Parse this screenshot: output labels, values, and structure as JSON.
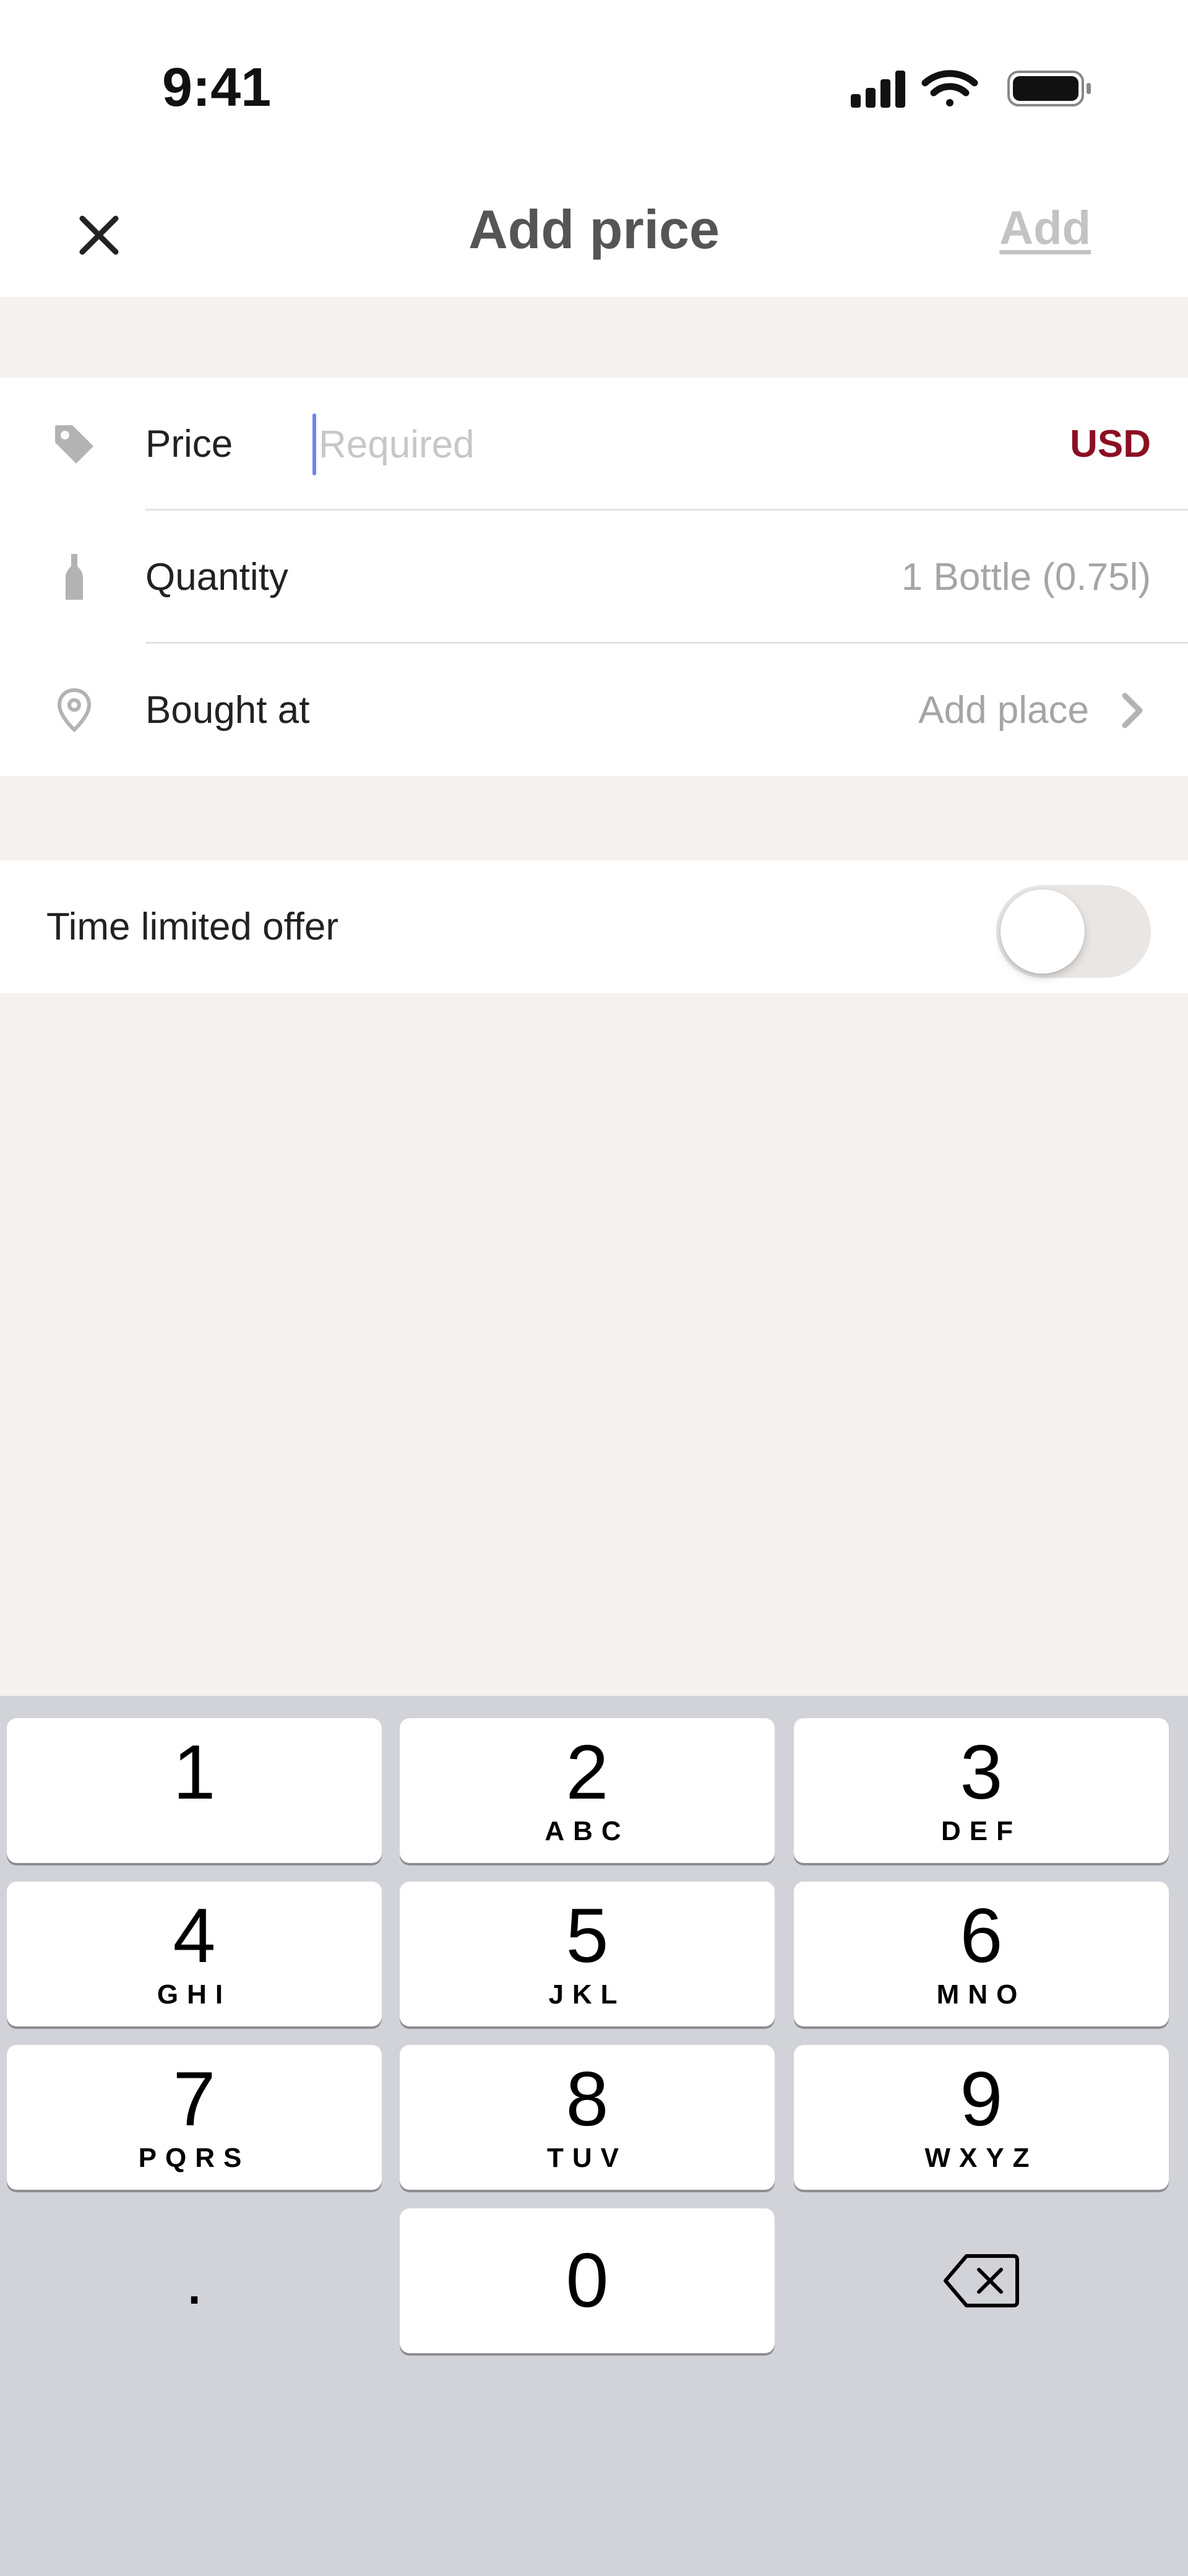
{
  "status_bar": {
    "time": "9:41"
  },
  "nav": {
    "title": "Add price",
    "add_label": "Add"
  },
  "form": {
    "price": {
      "label": "Price",
      "placeholder": "Required",
      "value": "",
      "currency": "USD"
    },
    "quantity": {
      "label": "Quantity",
      "value": "1 Bottle (0.75l)"
    },
    "bought_at": {
      "label": "Bought at",
      "value": "Add place"
    },
    "time_limited_offer": {
      "label": "Time limited offer",
      "enabled": false
    }
  },
  "keypad": {
    "keys": [
      {
        "num": "1",
        "letters": ""
      },
      {
        "num": "2",
        "letters": "ABC"
      },
      {
        "num": "3",
        "letters": "DEF"
      },
      {
        "num": "4",
        "letters": "GHI"
      },
      {
        "num": "5",
        "letters": "JKL"
      },
      {
        "num": "6",
        "letters": "MNO"
      },
      {
        "num": "7",
        "letters": "PQRS"
      },
      {
        "num": "8",
        "letters": "TUV"
      },
      {
        "num": "9",
        "letters": "WXYZ"
      },
      {
        "num": ".",
        "letters": ""
      },
      {
        "num": "0",
        "letters": ""
      }
    ]
  },
  "colors": {
    "accent": "#8b0f22",
    "caret": "#6b86e8",
    "background": "#f5f2ef",
    "keyboard": "#d1d3d9"
  },
  "icons": {
    "close": "close-icon",
    "price": "price-tag-icon",
    "quantity": "bottle-icon",
    "place": "location-pin-icon",
    "chevron": "chevron-right-icon",
    "delete": "backspace-icon"
  }
}
